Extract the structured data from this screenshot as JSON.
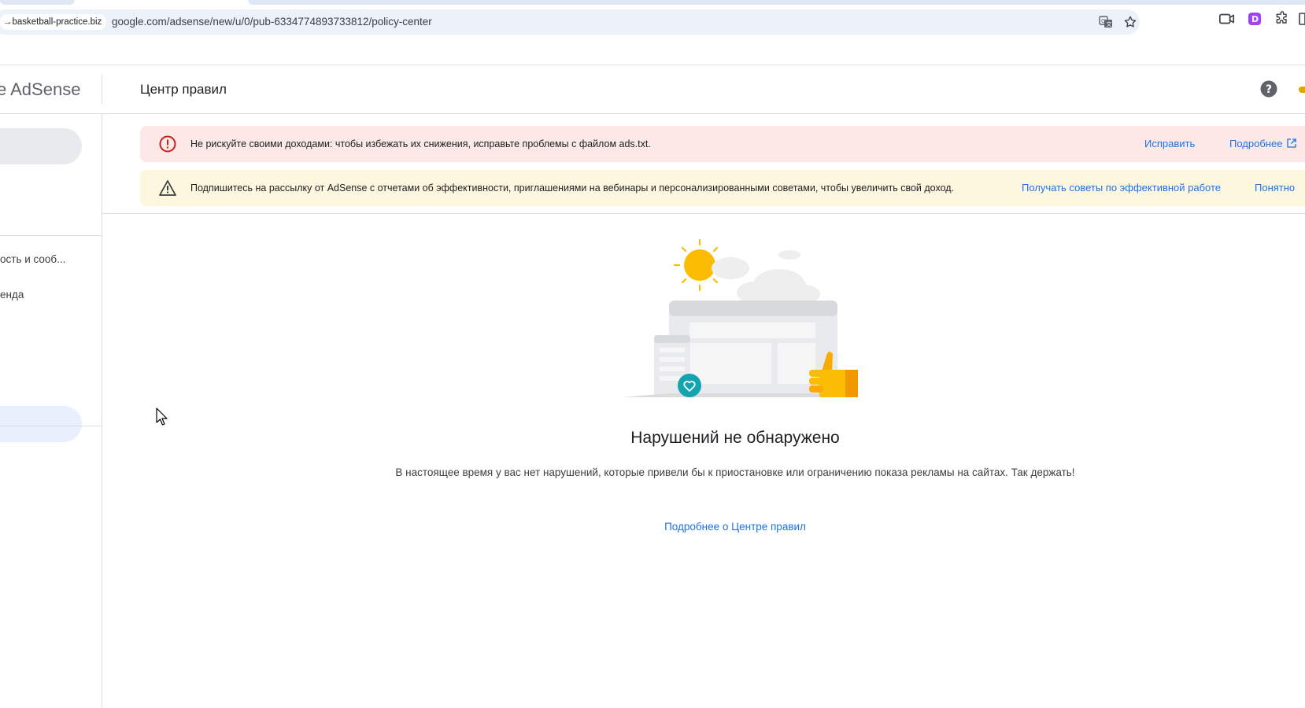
{
  "browser": {
    "site_chip": "→basketball-practice.biz",
    "url": "google.com/adsense/new/u/0/pub-6334774893733812/policy-center",
    "icons": [
      "translate-icon",
      "star-icon",
      "video-icon",
      "extension-d-icon",
      "puzzle-icon"
    ]
  },
  "header": {
    "brand": "e AdSense",
    "page_title": "Центр правил",
    "help_icon": "help-circle-icon"
  },
  "sidebar": {
    "items": [
      {
        "label": "ость и сооб..."
      },
      {
        "label": "енда"
      }
    ]
  },
  "alerts": {
    "error": {
      "text": "Не рискуйте своими доходами: чтобы избежать их снижения, исправьте проблемы с файлом ads.txt.",
      "fix_label": "Исправить",
      "more_label": "Подробнее",
      "color": "#fce8e6"
    },
    "newsletter": {
      "text": "Подпишитесь на рассылку от AdSense с отчетами об эффективности, приглашениями на вебинары и персонализированными советами, чтобы увеличить свой доход.",
      "subscribe_label": "Получать советы по эффективной работе",
      "dismiss_label": "Понятно",
      "color": "#fef7e0"
    }
  },
  "empty_state": {
    "title": "Нарушений не обнаружено",
    "description": "В настоящее время у вас нет нарушений, которые привели бы к приостановке или ограничению показа рекламы на сайтах. Так держать!",
    "link": "Подробнее о Центре правил"
  },
  "colors": {
    "accent": "#1a73e8",
    "error_icon": "#c5221f",
    "sun": "#fbbc04"
  }
}
